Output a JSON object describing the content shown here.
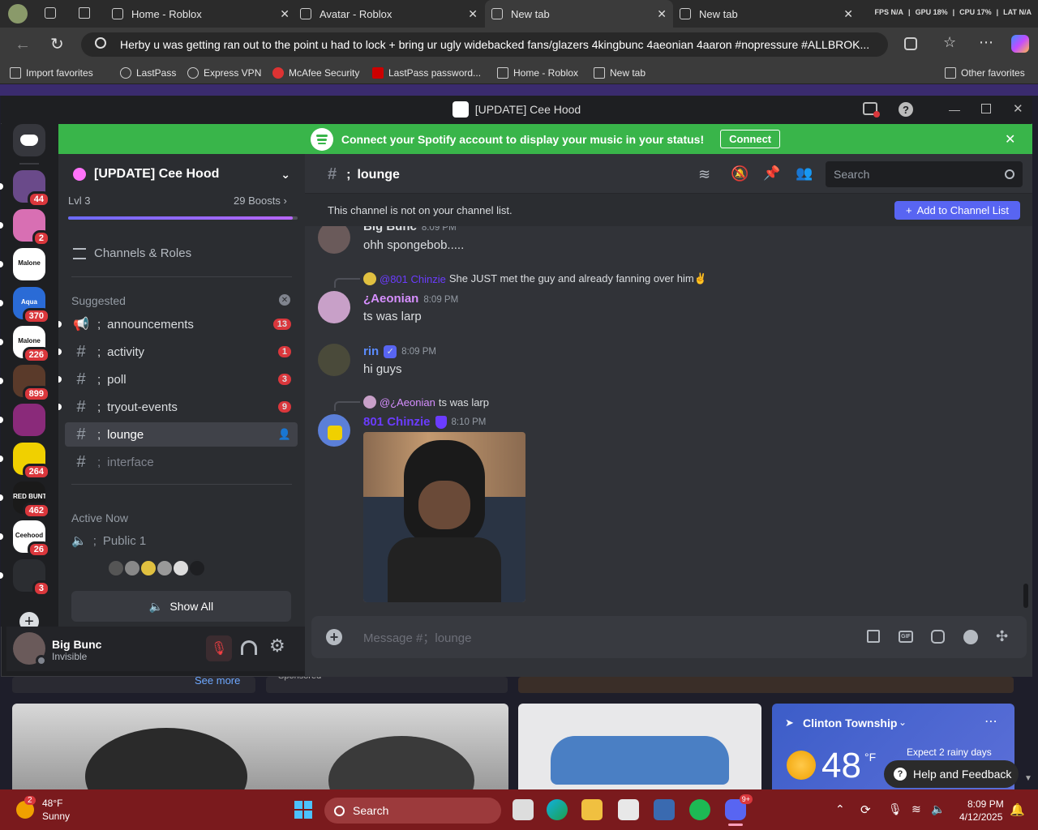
{
  "browser": {
    "tabs": [
      {
        "label": "Home - Roblox"
      },
      {
        "label": "Avatar - Roblox"
      },
      {
        "label": "New tab"
      },
      {
        "label": "New tab"
      }
    ],
    "stats": {
      "fps": "FPS N/A",
      "gpu": "GPU 18%",
      "cpu": "CPU 17%",
      "lat": "LAT N/A"
    },
    "address": "Herby u was getting ran out to the point u had to lock + bring ur ugly widebacked fans/glazers 4kingbunc 4aeonian 4aaron #nopressure #ALLBROK...",
    "favorites": [
      "Import favorites",
      "LastPass",
      "Express VPN",
      "McAfee Security",
      "LastPass password...",
      "Home - Roblox",
      "New tab"
    ],
    "other_favorites": "Other favorites"
  },
  "discord": {
    "window_title": "[UPDATE] Cee Hood",
    "spotify": {
      "text": "Connect your Spotify account to display your music in your status!",
      "button": "Connect"
    },
    "servers": [
      {
        "badge": "44",
        "color": "#6a4a8a"
      },
      {
        "badge": "2",
        "color": "#d86fb3"
      },
      {
        "badge": "",
        "color": "#ffffff",
        "label": "Malone"
      },
      {
        "badge": "370",
        "color": "#2a6bd6",
        "label": "Aqua"
      },
      {
        "badge": "226",
        "color": "#ffffff",
        "label": "Malone"
      },
      {
        "badge": "899",
        "color": "#5a3a2a"
      },
      {
        "badge": "",
        "color": "#8a2a7a"
      },
      {
        "badge": "264",
        "color": "#f0d000"
      },
      {
        "badge": "462",
        "color": "#1a1a1a",
        "label": "RED BUNTY!"
      },
      {
        "badge": "26",
        "color": "#ffffff",
        "label": "Ceehood"
      },
      {
        "badge": "3",
        "color": "#2b2d31"
      }
    ],
    "server_name": "[UPDATE] Cee Hood",
    "level": "Lvl 3",
    "boosts": "29 Boosts",
    "channels_roles": "Channels & Roles",
    "suggested": "Suggested",
    "channels": [
      {
        "name": "announcements",
        "badge": "13",
        "type": "announce"
      },
      {
        "name": "activity",
        "badge": "1",
        "type": "text"
      },
      {
        "name": "poll",
        "badge": "3",
        "type": "text"
      },
      {
        "name": "tryout-events",
        "badge": "9",
        "type": "text"
      },
      {
        "name": "lounge",
        "badge": "",
        "type": "text",
        "active": true
      },
      {
        "name": "interface",
        "badge": "",
        "type": "text",
        "muted": true
      }
    ],
    "separator": ";",
    "active_now": "Active Now",
    "voice_channel": "Public 1",
    "show_all": "Show All",
    "user": {
      "name": "Big Bunc",
      "status": "Invisible"
    },
    "channel_header": {
      "name": "lounge",
      "search_placeholder": "Search"
    },
    "notice": {
      "text": "This channel is not on your channel list.",
      "button": "Add to Channel List"
    },
    "messages": [
      {
        "author": "Big Bunc",
        "time": "8:09 PM",
        "text": "ohh spongebob.....",
        "color": "#dbdee1"
      },
      {
        "reply_to": "@801 Chinzie",
        "reply_text": "She JUST met the guy and already fanning over him✌️",
        "author": "¿Aeonian",
        "time": "8:09 PM",
        "text": "ts was larp",
        "color": "#d68fff"
      },
      {
        "author": "rin",
        "time": "8:09 PM",
        "text": "hi guys",
        "color": "#5b8cff"
      },
      {
        "reply_to": "@¿Aeonian",
        "reply_text": "ts was larp",
        "author": "801 Chinzie",
        "time": "8:10 PM",
        "text": "",
        "color": "#6b3cff"
      }
    ],
    "message_placeholder": "Message #；lounge"
  },
  "web": {
    "see_more": "See more",
    "sponsored": "Sponsored",
    "location": "Clinton Township",
    "forecast": "Expect 2 rainy days",
    "temp": "48",
    "unit": "°F",
    "help": "Help and Feedback"
  },
  "taskbar": {
    "weather_temp": "48°F",
    "weather_desc": "Sunny",
    "weather_badge": "2",
    "search": "Search",
    "discord_badge": "9+",
    "time": "8:09 PM",
    "date": "4/12/2025"
  }
}
